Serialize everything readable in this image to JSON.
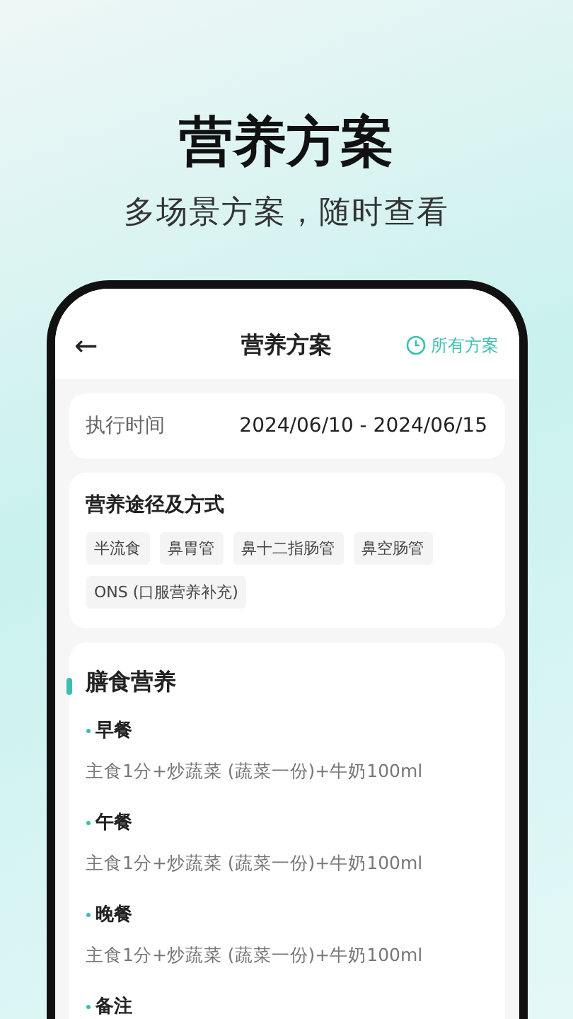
{
  "headline": "营养方案",
  "subtitle": "多场景方案，随时查看",
  "header": {
    "back": "←",
    "title": "营养方案",
    "action": "所有方案"
  },
  "period": {
    "label": "执行时间",
    "value": "2024/06/10 - 2024/06/15"
  },
  "routes": {
    "title": "营养途径及方式",
    "tags": [
      "半流食",
      "鼻胃管",
      "鼻十二指肠管",
      "鼻空肠管",
      "ONS (口服营养补充)"
    ]
  },
  "diet": {
    "title": "膳食营养",
    "meals": [
      {
        "name": "早餐",
        "detail": "主食1分+炒蔬菜 (蔬菜一份)+牛奶100ml"
      },
      {
        "name": "午餐",
        "detail": "主食1分+炒蔬菜 (蔬菜一份)+牛奶100ml"
      },
      {
        "name": "晚餐",
        "detail": "主食1分+炒蔬菜 (蔬菜一份)+牛奶100ml"
      },
      {
        "name": "备注"
      }
    ]
  }
}
